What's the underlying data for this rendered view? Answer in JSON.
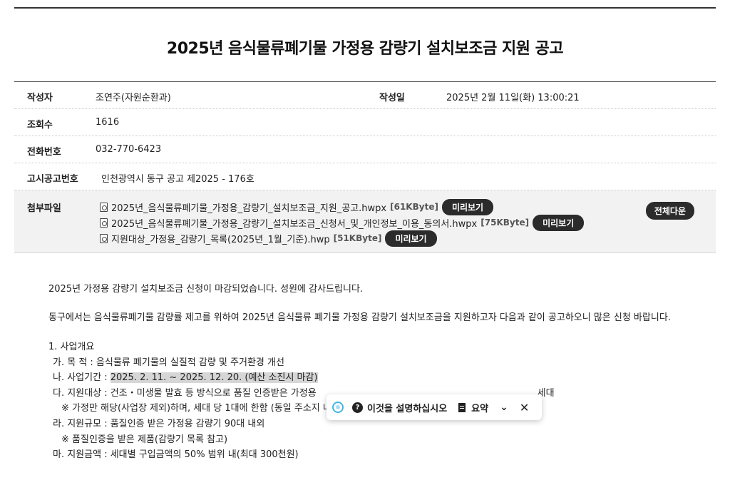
{
  "title": "2025년 음식물류폐기물 가정용 감량기 설치보조금 지원 공고",
  "info": {
    "author_label": "작성자",
    "author": "조연주(자원순환과)",
    "date_label": "작성일",
    "date": "2025년 2월 11일(화) 13:00:21",
    "views_label": "조회수",
    "views": "1616",
    "phone_label": "전화번호",
    "phone": "032-770-6423",
    "notice_label": "고시공고번호",
    "notice": "인천광역시 동구 공고 제2025 - 176호"
  },
  "attachments": {
    "label": "첨부파일",
    "download_all": "전체다운",
    "preview_label": "미리보기",
    "files": [
      {
        "name": "2025년_음식물류폐기물_가정용_감량기_설치보조금_지원_공고.hwpx",
        "size": "[61KByte]"
      },
      {
        "name": "2025년_음식물류폐기물_가정용_감량기_설치보조금_신청서_및_개인정보_이용_동의서.hwpx",
        "size": "[75KByte]"
      },
      {
        "name": "지원대상_가정용_감량기_목록(2025년_1월_기준).hwp",
        "size": "[51KByte]"
      }
    ]
  },
  "content": {
    "closing_notice": "2025년 가정용 감량기 설치보조금 신청이 마감되었습니다. 성원에 감사드립니다.",
    "intro": "동구에서는 음식물류폐기물 감량률 제고를 위하여 2025년 음식물류 폐기물 가정용 감량기 설치보조금을 지원하고자 다음과 같이 공고하오니 많은 신청 바랍니다.",
    "section1": "1. 사업개요",
    "purpose": "가. 목    적 : 음식물류 폐기물의 실질적 감량 및 주거환경 개선",
    "period_label": "나. 사업기간 : ",
    "period_value": "2025. 2. 11. ~ 2025. 12. 20. (예산 소진시 마감)",
    "target_start": "다. 지원대상 : 건조・미생물 발효 등 방식으로 품질 인증받은 가정용",
    "target_end": "세대",
    "target_note": "※ 가정만 해당(사업장 제외)하며, 세대 당 1대에 한함 (동일 주소지 내 중복지원 불가)",
    "scale": "라. 지원규모 : 품질인증 받은 가정용 감량기 90대 내외",
    "scale_note": "※ 품질인증을 받은 제품(감량기 목록 참고)",
    "amount": "마. 지원금액 : 세대별 구입금액의 50% 범위 내(최대 300천원)"
  },
  "toolbar": {
    "explain": "이것을 설명하십시오",
    "summary": "요약",
    "logo_icon": "assistant-logo-icon",
    "accent": "#42b4e6"
  }
}
